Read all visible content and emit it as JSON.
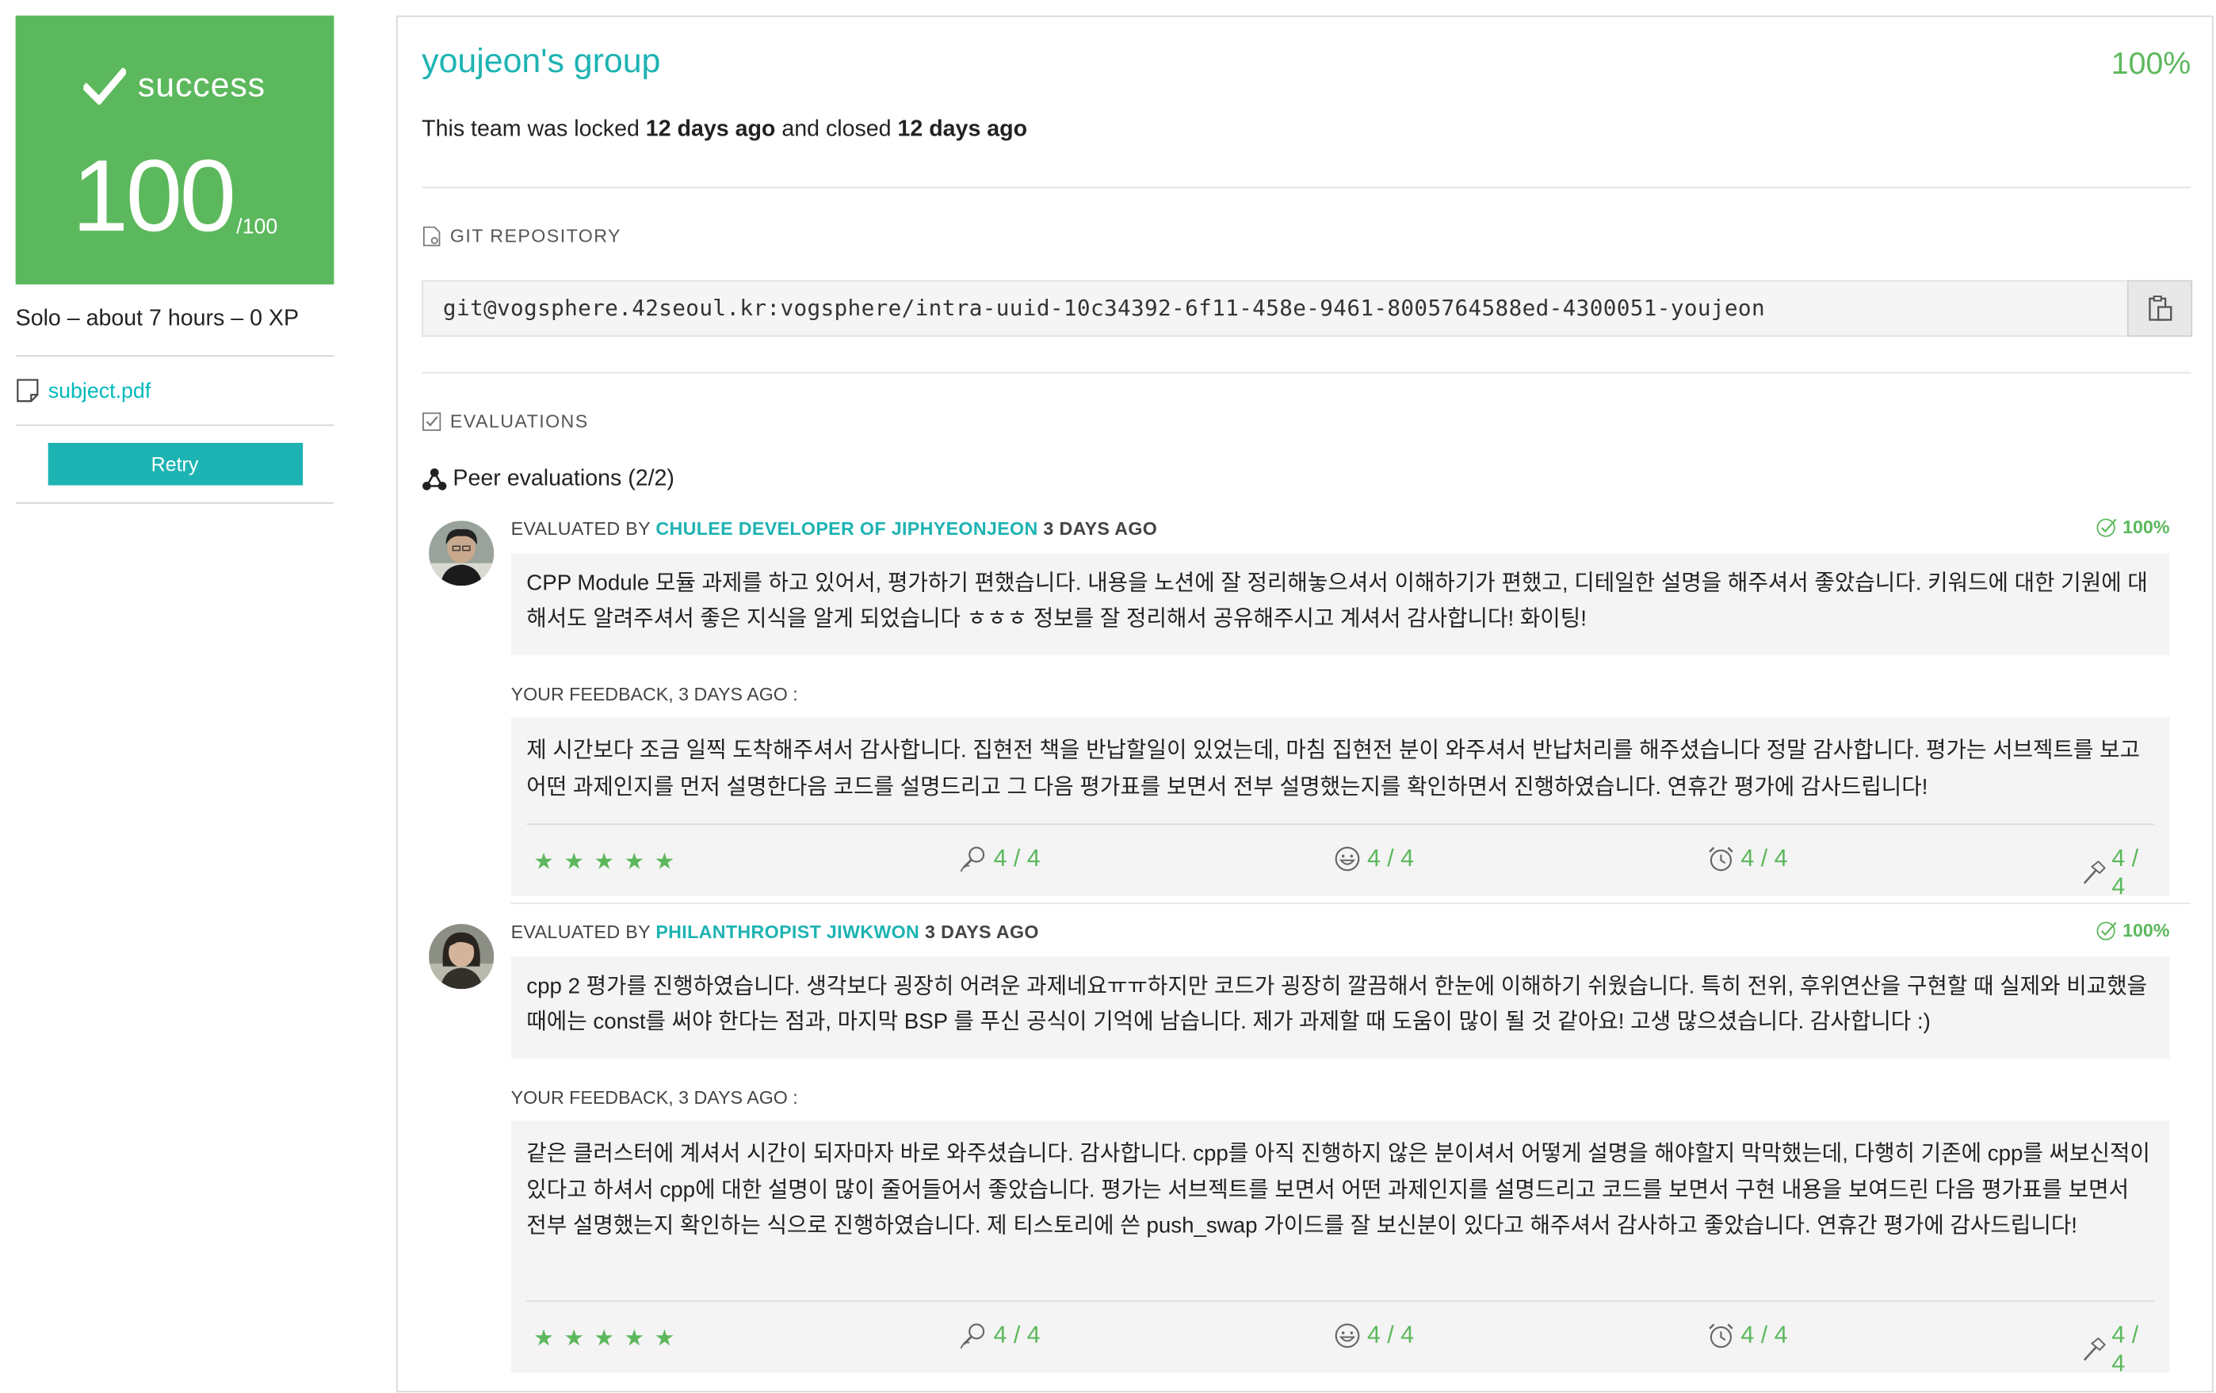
{
  "left": {
    "status": "success",
    "score": "100",
    "score_max": "/100",
    "meta": "Solo – about 7 hours – 0 XP",
    "subject_link": "subject.pdf",
    "retry_label": "Retry"
  },
  "team": {
    "name": "youjeon's group",
    "percent": "100%",
    "lock_prefix": "This team was locked",
    "locked_ago": "12 days ago",
    "lock_middle": "and closed",
    "closed_ago": "12 days ago"
  },
  "git": {
    "section_label": "GIT REPOSITORY",
    "url": "git@vogsphere.42seoul.kr:vogsphere/intra-uuid-10c34392-6f11-458e-9461-8005764588ed-4300051-youjeon"
  },
  "evaluations": {
    "section_label": "EVALUATIONS",
    "peer_label": "Peer evaluations (2/2)",
    "items": [
      {
        "prefix": "EVALUATED BY",
        "evaluator": "CHULEE DEVELOPER OF JIPHYEONJEON",
        "when": "3 DAYS AGO",
        "percent": "100%",
        "comment": "CPP Module 모듈 과제를 하고 있어서, 평가하기 편했습니다. 내용을 노션에 잘 정리해놓으셔서 이해하기가 편했고, 디테일한 설명을 해주셔서 좋았습니다. 키워드에 대한 기원에 대해서도 알려주셔서 좋은 지식을 알게 되었습니다 ㅎㅎㅎ 정보를 잘 정리해서 공유해주시고 계셔서 감사합니다! 화이팅!",
        "feedback_label": "YOUR FEEDBACK, 3 DAYS AGO :",
        "feedback": "제 시간보다 조금 일찍 도착해주셔서 감사합니다. 집현전 책을 반납할일이 있었는데, 마침 집현전 분이 와주셔서 반납처리를 해주셨습니다 정말 감사합니다. 평가는 서브젝트를 보고 어떤 과제인지를 먼저 설명한다음 코드를 설명드리고 그 다음 평가표를 보면서 전부 설명했는지를 확인하면서 진행하였습니다. 연휴간 평가에 감사드립니다!",
        "stars": "★★★★★",
        "ratings": [
          "4 / 4",
          "4 / 4",
          "4 / 4",
          "4 / 4"
        ]
      },
      {
        "prefix": "EVALUATED BY",
        "evaluator": "PHILANTHROPIST JIWKWON",
        "when": "3 DAYS AGO",
        "percent": "100%",
        "comment": "cpp 2 평가를 진행하였습니다. 생각보다 굉장히 어려운 과제네요ㅠㅠ하지만 코드가 굉장히 깔끔해서 한눈에 이해하기 쉬웠습니다. 특히 전위, 후위연산을 구현할 때 실제와 비교했을 때에는 const를 써야 한다는 점과, 마지막 BSP 를 푸신 공식이 기억에 남습니다. 제가 과제할 때 도움이 많이 될 것 같아요! 고생 많으셨습니다. 감사합니다 :)",
        "feedback_label": "YOUR FEEDBACK, 3 DAYS AGO :",
        "feedback": "같은 클러스터에 계셔서 시간이 되자마자 바로 와주셨습니다. 감사합니다. cpp를 아직 진행하지 않은 분이셔서 어떻게 설명을 해야할지 막막했는데, 다행히 기존에 cpp를 써보신적이 있다고 하셔서 cpp에 대한 설명이 많이 줄어들어서 좋았습니다. 평가는 서브젝트를 보면서 어떤 과제인지를 설명드리고 코드를 보면서 구현 내용을 보여드린 다음 평가표를 보면서 전부 설명했는지 확인하는 식으로 진행하였습니다. 제 티스토리에 쓴 push_swap 가이드를 잘 보신분이 있다고 해주셔서 감사하고 좋았습니다. 연휴간 평가에 감사드립니다!",
        "stars": "★★★★★",
        "ratings": [
          "4 / 4",
          "4 / 4",
          "4 / 4",
          "4 / 4"
        ]
      }
    ]
  },
  "colors": {
    "success": "#5cb85c",
    "accent": "#1eb3b3"
  },
  "icons": [
    "check-icon",
    "document-icon",
    "repository-icon",
    "clipboard-icon",
    "checkbox-icon",
    "peer-network-icon",
    "check-circle-icon",
    "star-icon",
    "search-user-icon",
    "smiley-icon",
    "alarm-clock-icon",
    "hammer-icon"
  ]
}
